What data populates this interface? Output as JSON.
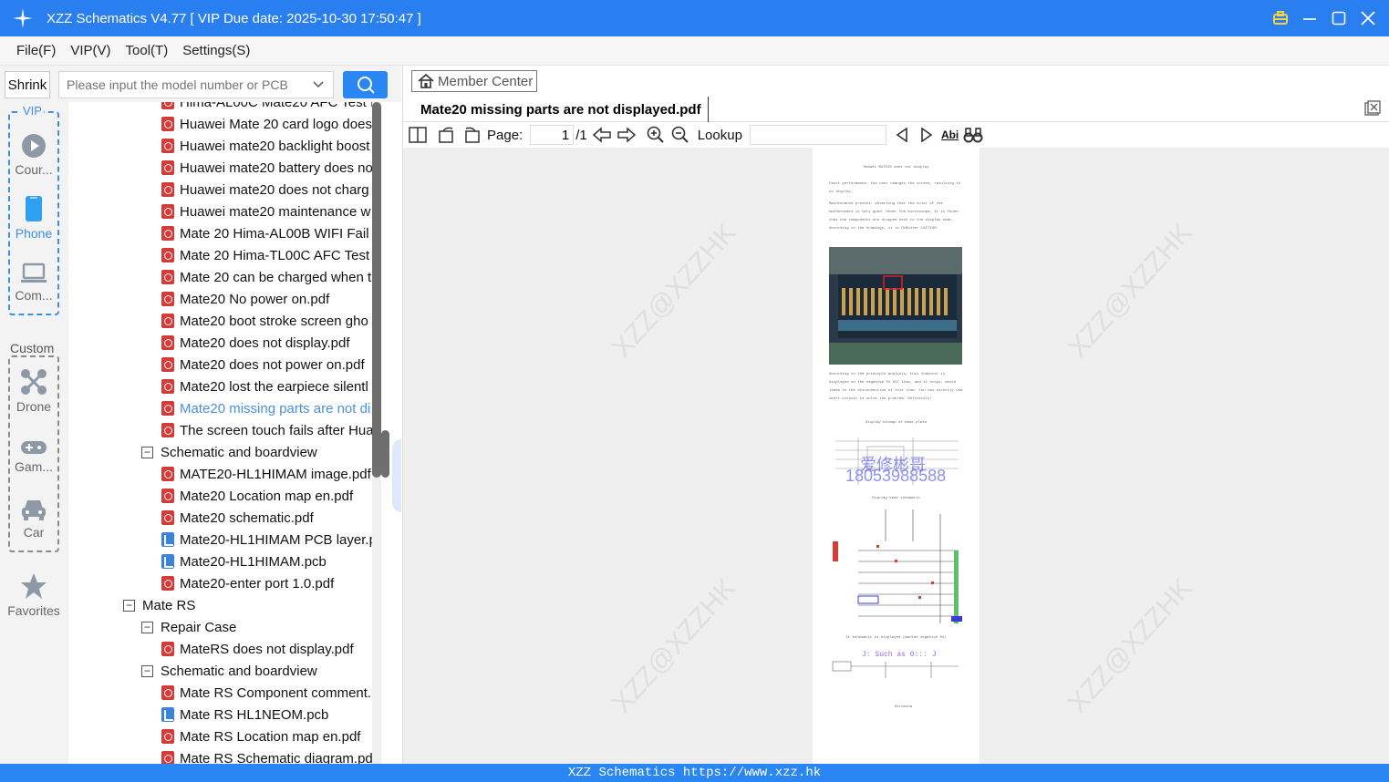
{
  "window": {
    "title": "XZZ Schematics V4.77 [ VIP Due date: 2025-10-30 17:50:47 ]"
  },
  "menu": [
    "File(F)",
    "VIP(V)",
    "Tool(T)",
    "Settings(S)"
  ],
  "toolbar_left": {
    "shrink_label": "Shrink",
    "search_placeholder": "Please input the model number or PCB"
  },
  "categories": {
    "vip_label": "VIP",
    "custom_label": "Custom",
    "items": [
      "Cour...",
      "Phone",
      "Com...",
      "Drone",
      "Gam...",
      "Car",
      "Favorites"
    ]
  },
  "tree": [
    {
      "type": "pdf",
      "label": "Hima-AL00C Mate20 AFC Test f"
    },
    {
      "type": "pdf",
      "label": "Huawei Mate 20 card logo does"
    },
    {
      "type": "pdf",
      "label": "Huawei mate20 backlight boost"
    },
    {
      "type": "pdf",
      "label": "Huawei mate20 battery does no"
    },
    {
      "type": "pdf",
      "label": "Huawei mate20 does not charg"
    },
    {
      "type": "pdf",
      "label": "Huawei mate20 maintenance w"
    },
    {
      "type": "pdf",
      "label": "Mate 20 Hima-AL00B WIFI Fail t"
    },
    {
      "type": "pdf",
      "label": "Mate 20 Hima-TL00C AFC Test f"
    },
    {
      "type": "pdf",
      "label": "Mate 20 can be charged when t"
    },
    {
      "type": "pdf",
      "label": "Mate20 No power on.pdf"
    },
    {
      "type": "pdf",
      "label": "Mate20 boot stroke screen gho"
    },
    {
      "type": "pdf",
      "label": "Mate20 does not display.pdf"
    },
    {
      "type": "pdf",
      "label": "Mate20 does not power on.pdf"
    },
    {
      "type": "pdf",
      "label": "Mate20 lost the earpiece silentl"
    },
    {
      "type": "pdf",
      "label": "Mate20 missing parts are not di",
      "selected": true
    },
    {
      "type": "pdf",
      "label": "The screen touch fails after Hua"
    },
    {
      "type": "folder",
      "label": "Schematic and boardview",
      "level": 2
    },
    {
      "type": "pdf",
      "label": "MATE20-HL1HIMAM image.pdf"
    },
    {
      "type": "pdf",
      "label": "Mate20 Location map en.pdf"
    },
    {
      "type": "pdf",
      "label": "Mate20 schematic.pdf"
    },
    {
      "type": "pcb",
      "label": "Mate20-HL1HIMAM PCB layer.p"
    },
    {
      "type": "pcb",
      "label": "Mate20-HL1HIMAM.pcb"
    },
    {
      "type": "pdf",
      "label": "Mate20-enter port 1.0.pdf"
    },
    {
      "type": "folder",
      "label": "Mate RS",
      "level": 1
    },
    {
      "type": "folder",
      "label": "Repair Case",
      "level": 2
    },
    {
      "type": "pdf",
      "label": "MateRS does not display.pdf"
    },
    {
      "type": "folder",
      "label": "Schematic and boardview",
      "level": 2
    },
    {
      "type": "pdf",
      "label": "Mate RS Component comment."
    },
    {
      "type": "pcb",
      "label": "Mate RS HL1NEOM.pcb"
    },
    {
      "type": "pdf",
      "label": "Mate RS Location map en.pdf"
    },
    {
      "type": "pdf",
      "label": "Mate RS Schematic diagram.pd"
    }
  ],
  "viewer": {
    "member_center": "Member Center",
    "tab_title": "Mate20 missing parts are not displayed.pdf",
    "page_label": "Page:",
    "page_current": "1",
    "page_total": "/1",
    "lookup_label": "Lookup",
    "watermark": "XZZ@XZZHK",
    "doc_title": "Huawei MATE20 does not display",
    "doc_text_1": "Fault performance: the user changes the screen, resulting in no display.",
    "doc_text_2": "Maintenance process: observing that the color of the motherboard is very good. Under the microscope, it is found that the components are dropped next to the display seat. According to the drawings, it is DiMuiter L8I7I00.",
    "doc_text_3": "According to the principle analysis, this Inductor is displayed on the negative 5V VCC line, and it drops, which leads to the disconnection of this line. You can directly use short-circuit to solve the problem. Definitely!",
    "doc_caption_1": "Display bitmap of base plate",
    "doc_stamp_1": "爱修彬哥",
    "doc_stamp_2": "18053988588",
    "doc_caption_2": "Display seat schematic",
    "doc_caption_3": "It schematic is displayed (marked negative 5V)",
    "doc_caption_4": "J: Such as 0::: J",
    "doc_caption_5": "Hirdinna"
  },
  "status": "XZZ Schematics https://www.xzz.hk",
  "colors": {
    "titlebar": "#2a7ff0",
    "accent": "#2a86f3",
    "pdf": "#d83a3a",
    "pcb": "#3b82d9",
    "selected": "#4a90e2"
  }
}
